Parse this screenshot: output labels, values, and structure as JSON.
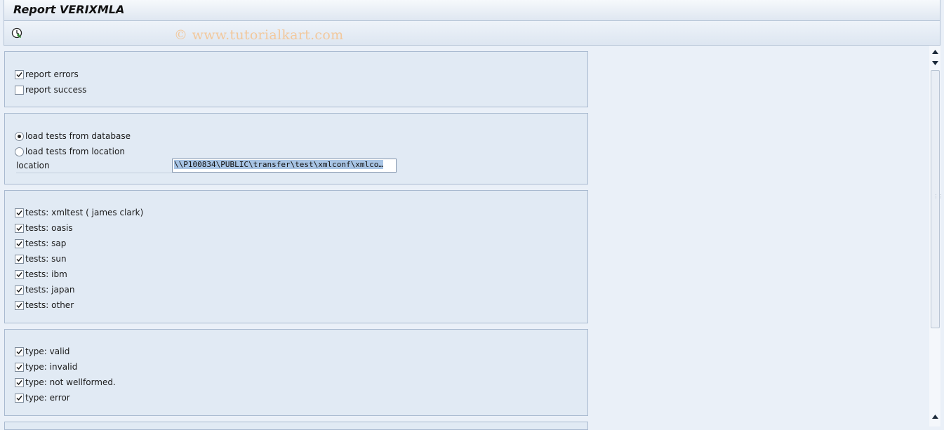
{
  "window": {
    "title": "Report VERIXMLA"
  },
  "toolbar": {
    "execute_icon": "execute-clock-icon",
    "watermark": "© www.tutorialkart.com"
  },
  "report_options": {
    "report_errors": {
      "label": "report errors",
      "checked": true
    },
    "report_success": {
      "label": "report success",
      "checked": false
    }
  },
  "source": {
    "from_database": {
      "label": "load tests from database",
      "selected": true
    },
    "from_location": {
      "label": "load tests from location",
      "selected": false
    },
    "location_label": "location",
    "location_value": "\\\\P100834\\PUBLIC\\transfer\\test\\xmlconf\\xmlco…"
  },
  "tests": [
    {
      "label": "tests: xmltest ( james clark)",
      "checked": true
    },
    {
      "label": "tests: oasis",
      "checked": true
    },
    {
      "label": "tests: sap",
      "checked": true
    },
    {
      "label": "tests: sun",
      "checked": true
    },
    {
      "label": "tests: ibm",
      "checked": true
    },
    {
      "label": "tests: japan",
      "checked": true
    },
    {
      "label": "tests: other",
      "checked": true
    }
  ],
  "types": [
    {
      "label": "type: valid",
      "checked": true
    },
    {
      "label": "type: invalid",
      "checked": true
    },
    {
      "label": "type: not wellformed.",
      "checked": true
    },
    {
      "label": "type: error",
      "checked": true
    }
  ]
}
